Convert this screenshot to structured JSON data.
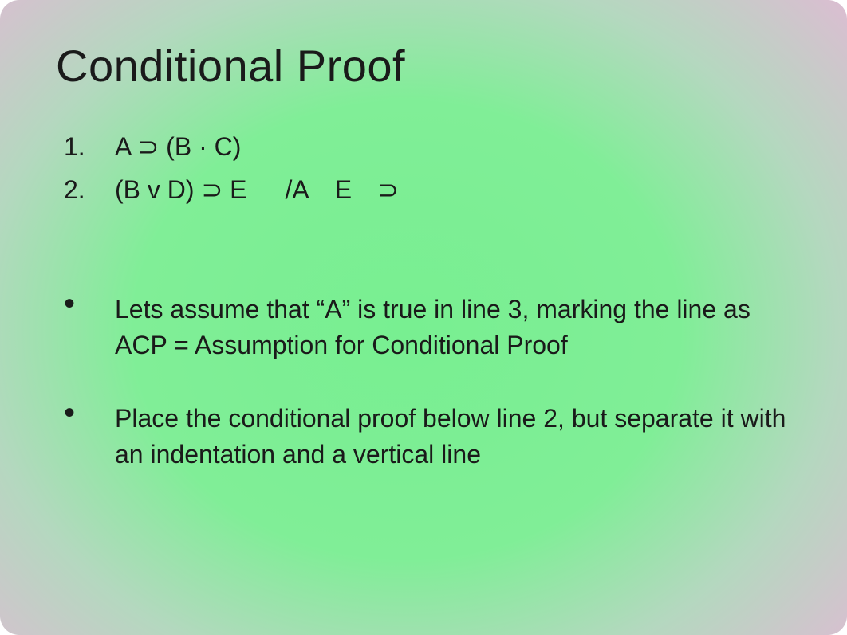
{
  "slide": {
    "title": "Conditional Proof",
    "premises": [
      {
        "num": "1.",
        "expr": "A ⊃ (B · C)"
      },
      {
        "num": "2.",
        "expr": "(B v D) ⊃ E  /A E ⊃"
      }
    ],
    "bullets": [
      "Lets assume that “A” is true in line 3, marking the line as ACP = Assumption for Conditional Proof",
      "Place the conditional proof below line 2, but separate it with an indentation and a vertical line"
    ]
  }
}
